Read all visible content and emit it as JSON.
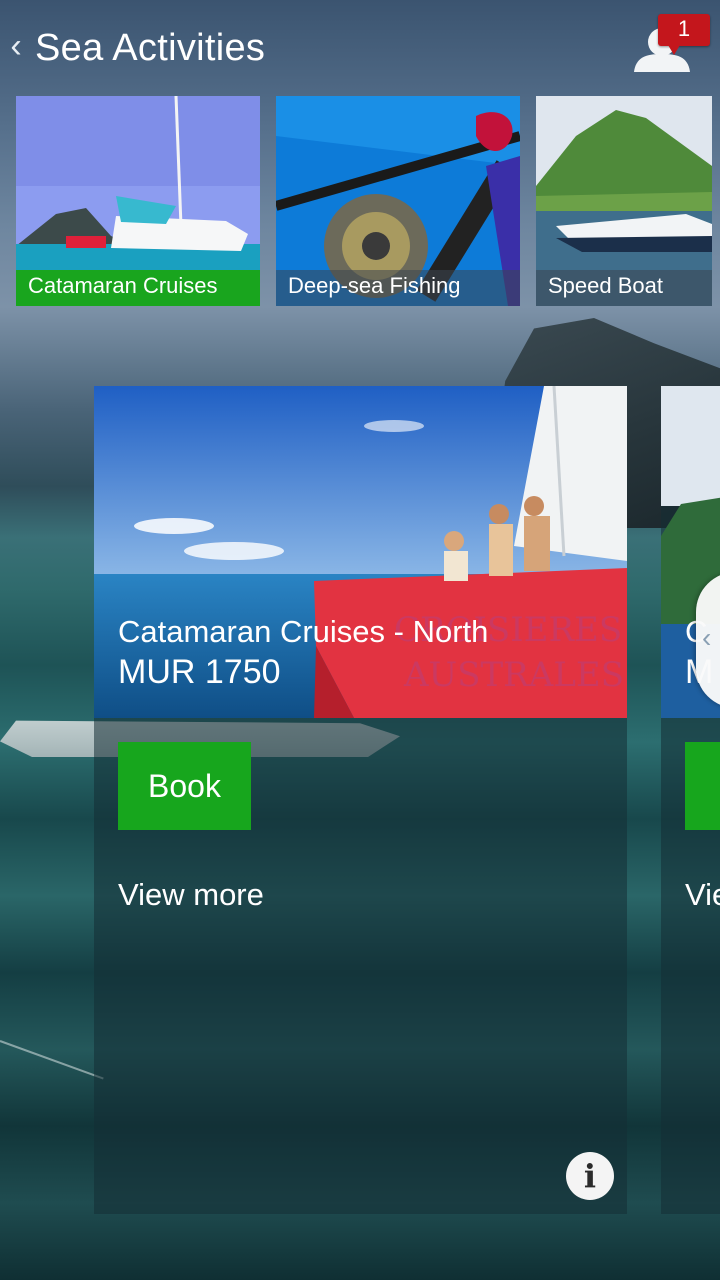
{
  "header": {
    "back_icon": "‹",
    "title": "Sea Activities",
    "notification_count": "1"
  },
  "categories": [
    {
      "label": "Catamaran Cruises",
      "selected": true
    },
    {
      "label": "Deep-sea Fishing",
      "selected": false
    },
    {
      "label": "Speed Boat",
      "selected": false
    }
  ],
  "card": {
    "title": "Catamaran Cruises - North",
    "price": "MUR 1750",
    "book_label": "Book",
    "view_more_label": "View more",
    "info_icon": "i"
  },
  "card_next": {
    "title": "C",
    "price": "M",
    "view_more_label": "Vie",
    "handle_icon": "‹"
  },
  "colors": {
    "accent_green": "#17a61d",
    "badge_red": "#c4161c"
  }
}
